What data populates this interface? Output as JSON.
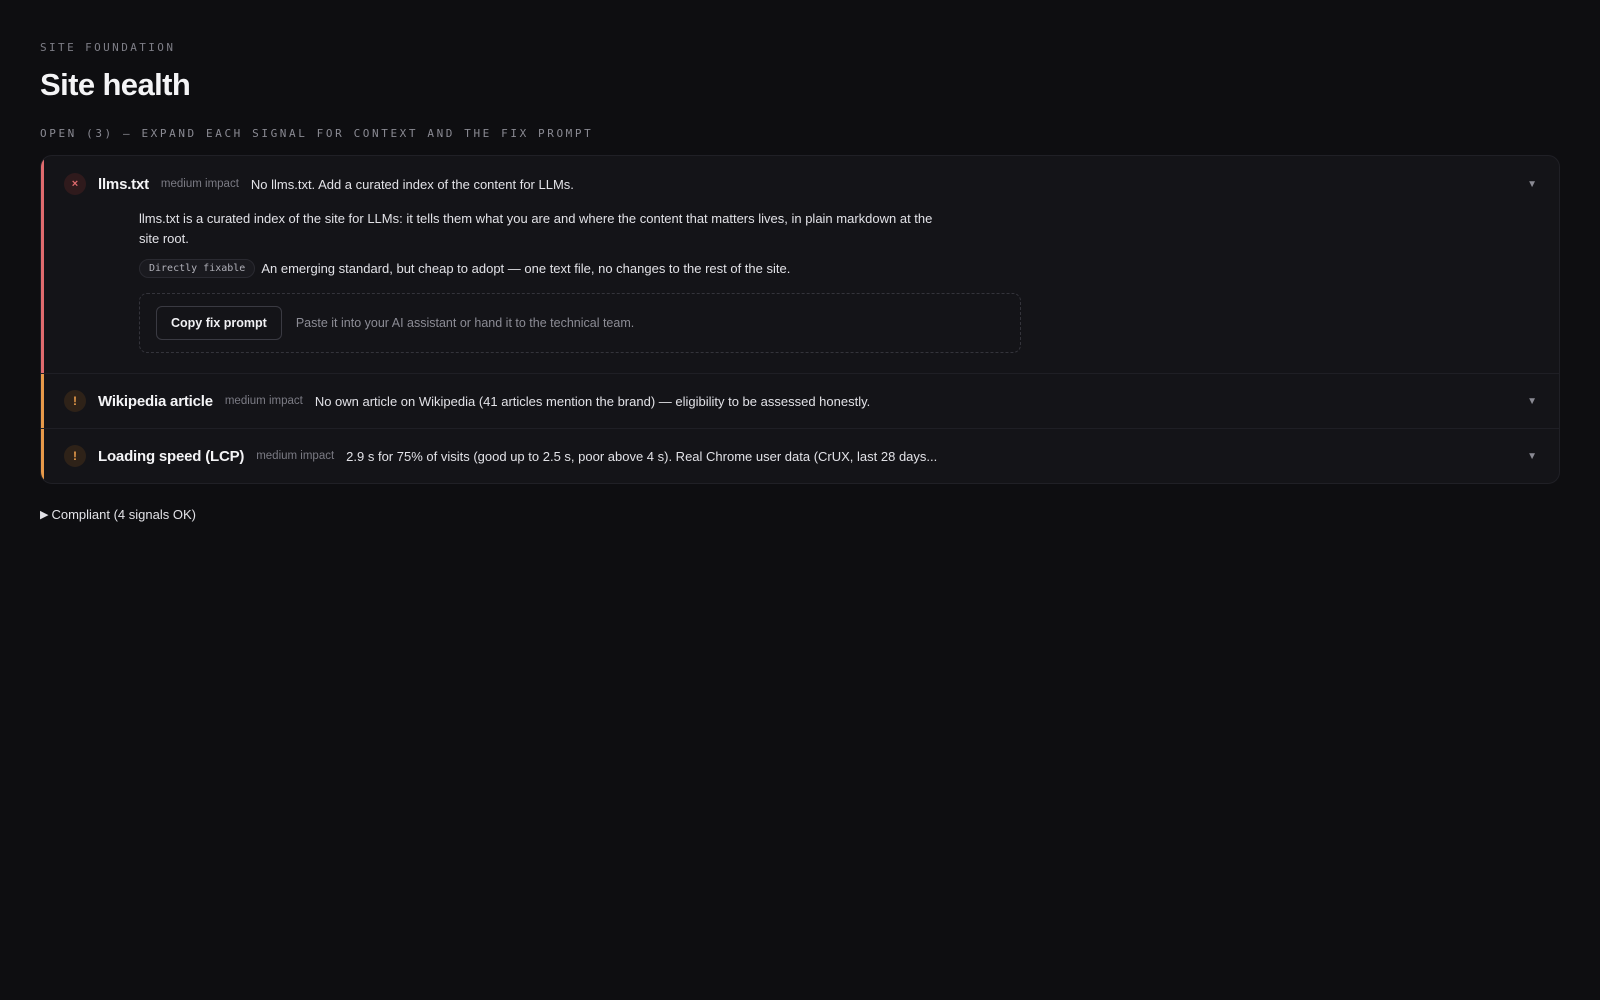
{
  "header": {
    "eyebrow": "SITE FOUNDATION",
    "title": "Site health",
    "section_label": "OPEN (3) — EXPAND EACH SIGNAL FOR CONTEXT AND THE FIX PROMPT"
  },
  "signals": [
    {
      "status": "critical",
      "status_icon": "×",
      "title": "llms.txt",
      "impact": "medium impact",
      "summary": "No llms.txt. Add a curated index of the content for LLMs.",
      "expanded": true,
      "description": "llms.txt is a curated index of the site for LLMs: it tells them what you are and where the content that matters lives, in plain markdown at the site root.",
      "fixable_tag": "Directly fixable",
      "fix_note": "An emerging standard, but cheap to adopt — one text file, no changes to the rest of the site.",
      "copy_button": "Copy fix prompt",
      "prompt_hint": "Paste it into your AI assistant or hand it to the technical team."
    },
    {
      "status": "warning",
      "status_icon": "!",
      "title": "Wikipedia article",
      "impact": "medium impact",
      "summary": "No own article on Wikipedia (41 articles mention the brand) — eligibility to be assessed honestly.",
      "expanded": false
    },
    {
      "status": "warning",
      "status_icon": "!",
      "title": "Loading speed (LCP)",
      "impact": "medium impact",
      "summary": "2.9 s for 75% of visits (good up to 2.5 s, poor above 4 s). Real Chrome user data (CrUX, last 28 days...",
      "expanded": false
    }
  ],
  "compliant_toggle": {
    "icon": "▶",
    "label": "Compliant (4 signals OK)"
  },
  "colors": {
    "critical": "#e06b6e",
    "warning": "#e79a4a",
    "background": "#0e0e11",
    "panel": "#141418"
  },
  "icons": {
    "critical": "close-icon",
    "warning": "exclamation-icon",
    "chevron": "chevron-down-icon",
    "compliant": "triangle-right-icon"
  }
}
